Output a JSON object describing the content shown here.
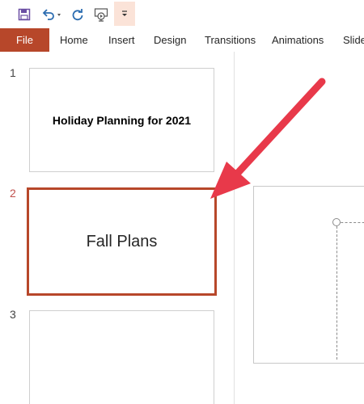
{
  "quick_access_toolbar": {
    "icons": [
      "save-icon",
      "undo-icon",
      "redo-icon",
      "present-icon",
      "customize-icon"
    ]
  },
  "ribbon": {
    "tabs": [
      "File",
      "Home",
      "Insert",
      "Design",
      "Transitions",
      "Animations",
      "Slide"
    ]
  },
  "slides": [
    {
      "number": "1",
      "title": "Holiday Planning for 2021"
    },
    {
      "number": "2",
      "title": "Fall Plans",
      "selected": true
    },
    {
      "number": "3",
      "title": ""
    }
  ],
  "colors": {
    "accent": "#b7472a",
    "active_number": "#c0504d",
    "annotation_arrow": "#e8394a"
  }
}
